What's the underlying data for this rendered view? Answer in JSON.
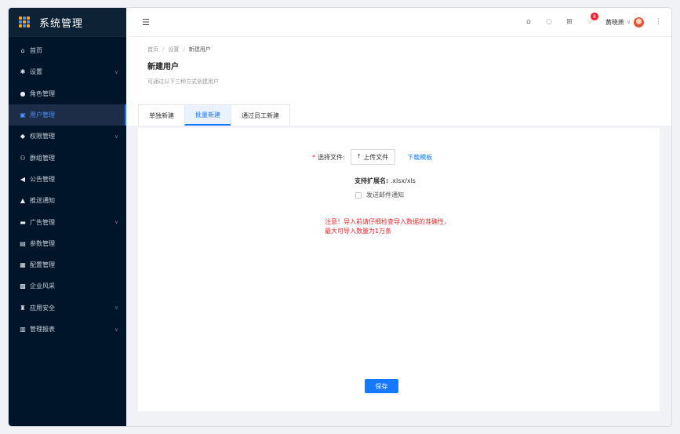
{
  "app": {
    "title": "系统管理"
  },
  "sidebar": {
    "items": [
      {
        "label": "首页",
        "icon": "home-icon",
        "glyph": "⌂",
        "arrow": false,
        "active": false
      },
      {
        "label": "设置",
        "icon": "gear-icon",
        "glyph": "✱",
        "arrow": true,
        "active": false
      },
      {
        "label": "角色管理",
        "icon": "user-circle-icon",
        "glyph": "●",
        "arrow": false,
        "active": false
      },
      {
        "label": "用户管理",
        "icon": "user-card-icon",
        "glyph": "▣",
        "arrow": false,
        "active": true
      },
      {
        "label": "权限管理",
        "icon": "shield-icon",
        "glyph": "◆",
        "arrow": true,
        "active": false
      },
      {
        "label": "群组管理",
        "icon": "group-icon",
        "glyph": "⚇",
        "arrow": false,
        "active": false
      },
      {
        "label": "公告管理",
        "icon": "megaphone-icon",
        "glyph": "◀",
        "arrow": false,
        "active": false
      },
      {
        "label": "推送通知",
        "icon": "bell-icon",
        "glyph": "▲",
        "arrow": false,
        "active": false
      },
      {
        "label": "广告管理",
        "icon": "ad-icon",
        "glyph": "▬",
        "arrow": true,
        "active": false
      },
      {
        "label": "参数管理",
        "icon": "params-icon",
        "glyph": "▤",
        "arrow": false,
        "active": false
      },
      {
        "label": "配置管理",
        "icon": "config-icon",
        "glyph": "▦",
        "arrow": false,
        "active": false
      },
      {
        "label": "企业风采",
        "icon": "enterprise-icon",
        "glyph": "▩",
        "arrow": false,
        "active": false
      },
      {
        "label": "应用安全",
        "icon": "lock-icon",
        "glyph": "♜",
        "arrow": true,
        "active": false
      },
      {
        "label": "管理报表",
        "icon": "report-icon",
        "glyph": "▥",
        "arrow": true,
        "active": false
      }
    ]
  },
  "header": {
    "menu_toggle_glyph": "☰",
    "notification_count": "8",
    "username": "黄晓燕"
  },
  "breadcrumb": {
    "home": "首页",
    "settings": "设置",
    "current": "新建用户",
    "sep": "/"
  },
  "page": {
    "title": "新建用户",
    "desc": "可通过以下三种方式创建用户"
  },
  "tabs": [
    {
      "label": "单独新建",
      "active": false
    },
    {
      "label": "批量新建",
      "active": true
    },
    {
      "label": "通过员工新建",
      "active": false
    }
  ],
  "form": {
    "required_mark": "*",
    "file_label": "选择文件:",
    "upload_button": "上传文件",
    "download_link": "下载模板",
    "ext_label": "支持扩展名:",
    "ext_value": ".xlsx/xls",
    "email_label": "发送邮件通知",
    "email_checked": false,
    "warning_line1": "注意！导入前请仔细检查导入数据的准确性，",
    "warning_line2": "最大可导入数量为1万条",
    "save_button": "保存"
  },
  "colors": {
    "primary": "#1677ff",
    "sidebar_bg": "#001529",
    "danger": "#f5222d"
  }
}
